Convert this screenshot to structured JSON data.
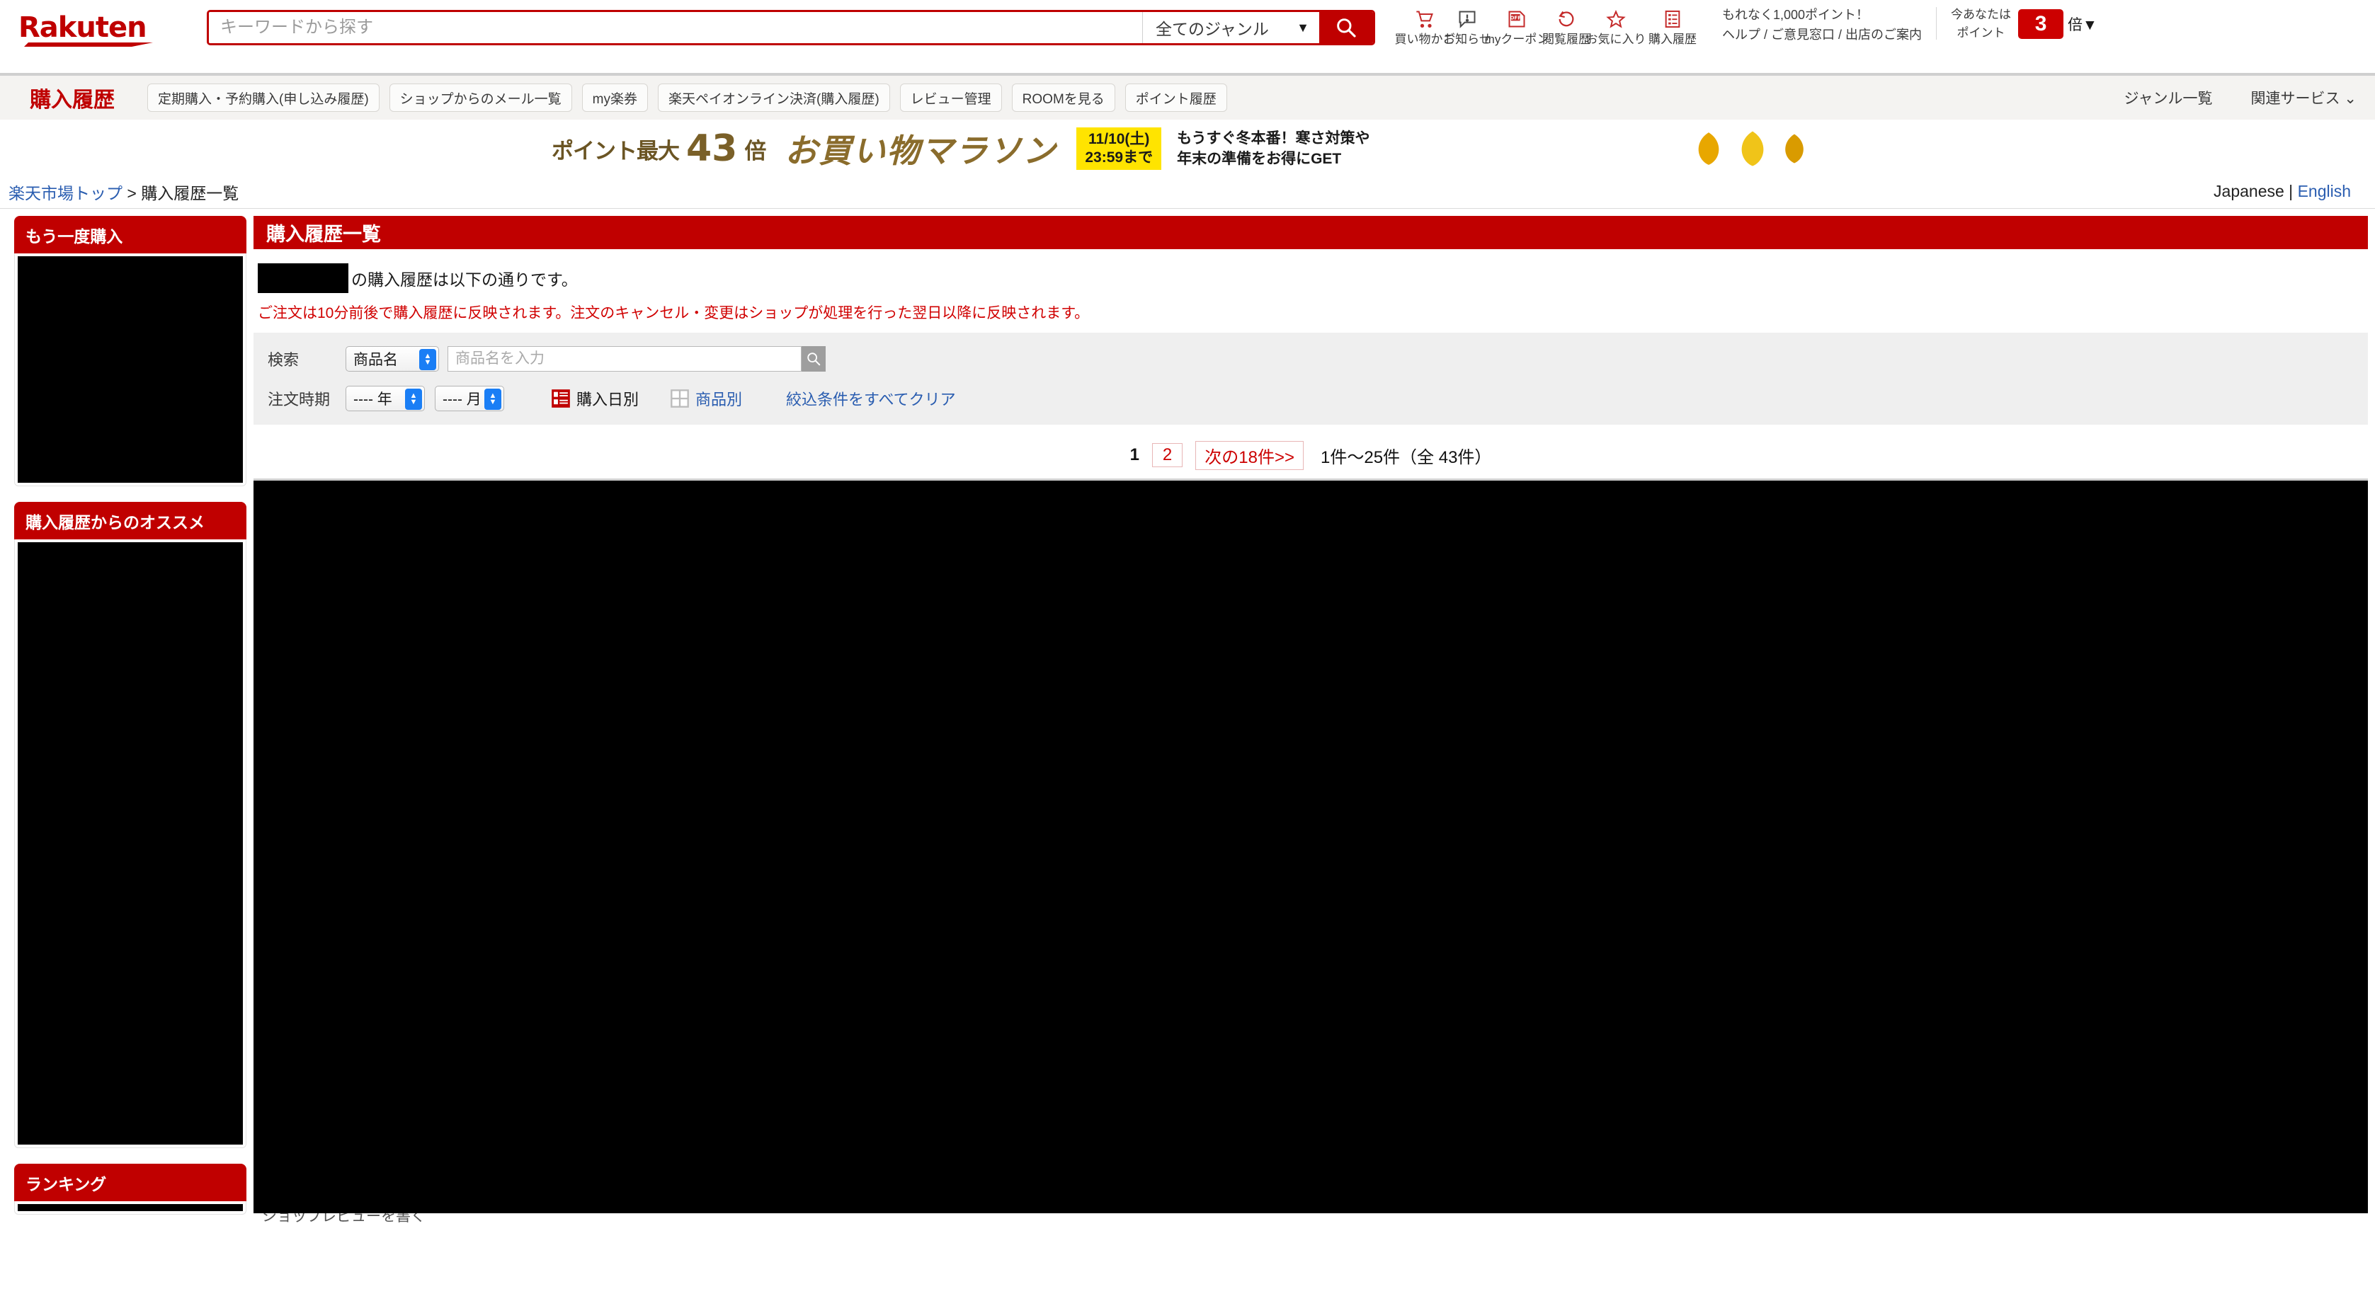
{
  "header": {
    "logo_text": "Rakuten",
    "search": {
      "placeholder": "キーワードから探す",
      "value": "",
      "genre_selected": "全てのジャンル",
      "genre_caret": "▼",
      "search_icon": "search-icon"
    },
    "icons": [
      {
        "name": "cart-icon",
        "label": "買い物かご"
      },
      {
        "name": "notice-icon",
        "label": "お知らせ"
      },
      {
        "name": "coupon-icon",
        "label": "myクーポン"
      },
      {
        "name": "history-icon",
        "label": "閲覧履歴"
      },
      {
        "name": "favorite-star-icon",
        "label": "お気に入り"
      },
      {
        "name": "purchase-history-icon",
        "label": "購入履歴"
      }
    ],
    "promo_line": "もれなく1,000ポイント！",
    "help_links": [
      "ヘルプ",
      "ご意見窓口",
      "出店のご案内"
    ],
    "help_separator": " / ",
    "points_label_line1": "今あなたは",
    "points_label_line2": "ポイント",
    "points_multiplier": "3",
    "points_suffix": "倍",
    "points_caret": "▼"
  },
  "local_nav": {
    "title": "購入履歴",
    "buttons": [
      "定期購入・予約購入(申し込み履歴)",
      "ショップからのメール一覧",
      "my楽券",
      "楽天ペイオンライン決済(購入履歴)",
      "レビュー管理",
      "ROOMを見る",
      "ポイント履歴"
    ],
    "right_links": [
      {
        "label": "ジャンル一覧",
        "caret": ""
      },
      {
        "label": "関連サービス",
        "caret": "⌄"
      }
    ]
  },
  "banner": {
    "points_prefix": "ポイント最大",
    "points_value": "43",
    "points_suffix": "倍",
    "campaign": "お買い物マラソン",
    "date_line1": "11/10(土)",
    "date_line2": "23:59まで",
    "copy_line1": "もうすぐ冬本番！寒さ対策や",
    "copy_line2": "年末の準備をお得にGET"
  },
  "breadcrumb": {
    "home": "楽天市場トップ",
    "separator": " > ",
    "current": "購入履歴一覧"
  },
  "language": {
    "japanese": "Japanese",
    "separator": " | ",
    "english": "English"
  },
  "sidebar": {
    "cards": [
      {
        "title": "もう一度購入",
        "has_body": true,
        "body_height": 320
      },
      {
        "title": "購入履歴からのオススメ",
        "has_body": true,
        "body_height": 440
      },
      {
        "title": "ランキング",
        "has_body": false,
        "body_height": 0
      }
    ]
  },
  "main": {
    "page_title": "購入履歴一覧",
    "intro_suffix": "の購入履歴は以下の通りです。",
    "warning": "ご注文は10分前後で購入履歴に反映されます。注文のキャンセル・変更はショップが処理を行った翌日以降に反映されます。",
    "filter": {
      "search_label": "検索",
      "search_type_selected": "商品名",
      "search_input_placeholder": "商品名を入力",
      "search_input_value": "",
      "search_button_icon": "magnifier-icon",
      "period_label": "注文時期",
      "year_selected": "---- 年",
      "month_selected": "---- 月",
      "view_by_date_label": "購入日別",
      "view_by_item_label": "商品別",
      "clear_filters_label": "絞込条件をすべてクリア"
    },
    "pagination": {
      "current_page": "1",
      "next_page": "2",
      "next_label": "次の18件>>",
      "range_text": "1件〜25件（全 43件）"
    },
    "bottom_partial_text": "ショップレビューを書く"
  },
  "colors": {
    "brand_red": "#bf0000",
    "header_red": "#c00000",
    "link_blue": "#2a5db0",
    "nav_bg": "#f4f3f1",
    "filter_bg": "#efefef",
    "warning_red": "#d00000"
  }
}
